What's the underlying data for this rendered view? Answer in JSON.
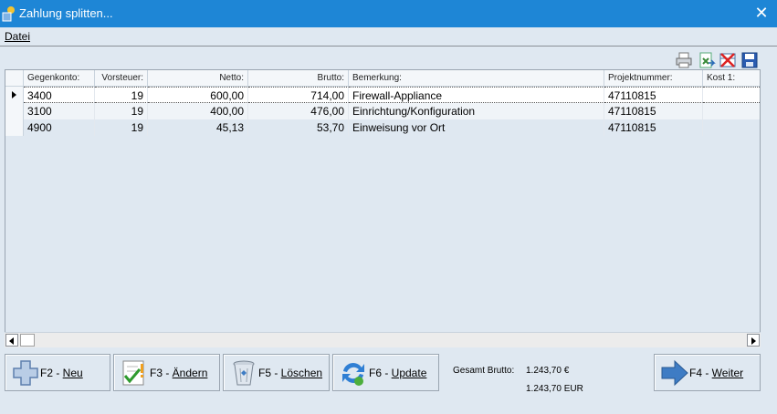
{
  "window": {
    "title": "Zahlung splitten...",
    "close_symbol": "✕"
  },
  "menu": {
    "datei_label": "Datei"
  },
  "toolbar": {
    "icons": [
      "printer-icon",
      "export-icon",
      "delete-layout-icon",
      "save-icon"
    ]
  },
  "grid": {
    "columns": [
      "Gegenkonto:",
      "Vorsteuer:",
      "Netto:",
      "Brutto:",
      "Bemerkung:",
      "Projektnummer:",
      "Kost 1:"
    ],
    "rows": [
      {
        "gegenkonto": "3400",
        "vorsteuer": "19",
        "netto": "600,00",
        "brutto": "714,00",
        "bemerkung": "Firewall-Appliance",
        "projektnummer": "47110815",
        "kost1": ""
      },
      {
        "gegenkonto": "3100",
        "vorsteuer": "19",
        "netto": "400,00",
        "brutto": "476,00",
        "bemerkung": "Einrichtung/Konfiguration",
        "projektnummer": "47110815",
        "kost1": ""
      },
      {
        "gegenkonto": "4900",
        "vorsteuer": "19",
        "netto": "45,13",
        "brutto": "53,70",
        "bemerkung": "Einweisung vor Ort",
        "projektnummer": "47110815",
        "kost1": ""
      }
    ],
    "selected_row": 0
  },
  "buttons": {
    "neu": {
      "prefix": "F2 - ",
      "label": "Neu"
    },
    "aendern": {
      "prefix": "F3 - ",
      "label": "Ändern"
    },
    "loeschen": {
      "prefix": "F5 - ",
      "label": "Löschen"
    },
    "update": {
      "prefix": "F6 - ",
      "label": "Update"
    },
    "weiter": {
      "prefix": "F4 - ",
      "label": "Weiter"
    }
  },
  "totals": {
    "label": "Gesamt Brutto:",
    "value_symbol": "1.243,70 €",
    "value_code": "1.243,70 EUR"
  },
  "colors": {
    "titlebar": "#1e86d6",
    "background": "#dfe8f1",
    "arrow_blue": "#3e7cc4"
  }
}
